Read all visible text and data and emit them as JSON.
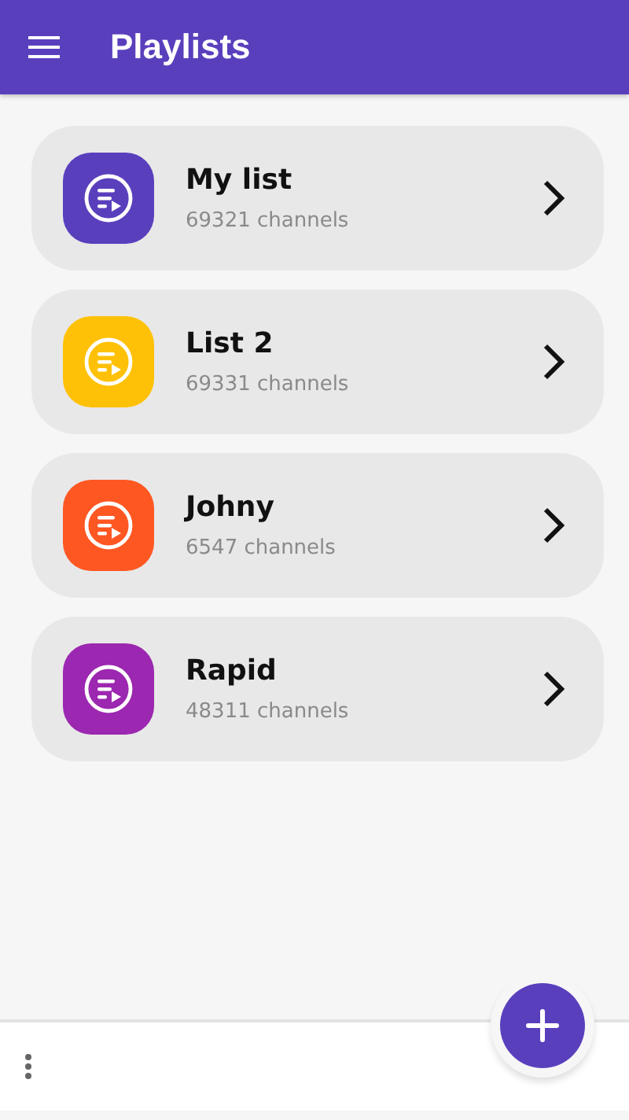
{
  "app_bar": {
    "title": "Playlists"
  },
  "playlists": [
    {
      "name": "My list",
      "count": "69321 channels",
      "color": "#5a3fbd"
    },
    {
      "name": "List 2",
      "count": "69331 channels",
      "color": "#ffc107"
    },
    {
      "name": "Johny",
      "count": "6547 channels",
      "color": "#ff5722"
    },
    {
      "name": "Rapid",
      "count": "48311 channels",
      "color": "#9c27b0"
    }
  ]
}
